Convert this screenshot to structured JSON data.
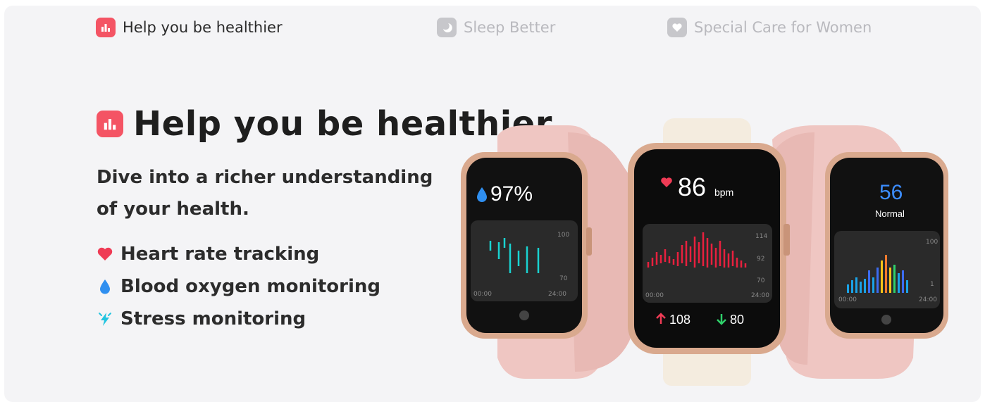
{
  "tabs": [
    {
      "label": "Help you be healthier",
      "icon": "bar-chart-icon",
      "active": true
    },
    {
      "label": "Sleep Better",
      "icon": "moon-icon",
      "active": false
    },
    {
      "label": "Special Care for Women",
      "icon": "heart-icon",
      "active": false
    }
  ],
  "section": {
    "title": "Help you be healthier",
    "subtitle": "Dive into a richer understanding of your health.",
    "features": [
      {
        "label": "Heart rate tracking",
        "icon": "heart-icon",
        "color": "#ef3b55"
      },
      {
        "label": "Blood oxygen monitoring",
        "icon": "droplet-icon",
        "color": "#2f8ff0"
      },
      {
        "label": "Stress monitoring",
        "icon": "stress-bolt-icon",
        "color": "#22c4e0"
      }
    ]
  },
  "watches": {
    "left": {
      "value": "97%",
      "y_top": "100",
      "y_bottom": "70",
      "x_start": "00:00",
      "x_end": "24:00",
      "accent": "#19d3d1"
    },
    "center": {
      "value": "86",
      "unit": "bpm",
      "y_top": "114",
      "y_mid": "92",
      "y_bottom": "70",
      "x_start": "00:00",
      "x_end": "24:00",
      "max": "108",
      "min": "80",
      "accent": "#e8203e"
    },
    "right": {
      "value": "56",
      "status": "Normal",
      "y_top": "100",
      "y_bottom": "1",
      "x_start": "00:00",
      "x_end": "24:00"
    }
  },
  "colors": {
    "brand": "#f45464",
    "background": "#f4f4f6",
    "strap_pink": "#efc6c2",
    "strap_white": "#f4ecdf",
    "case_gold": "#d9a98e"
  }
}
